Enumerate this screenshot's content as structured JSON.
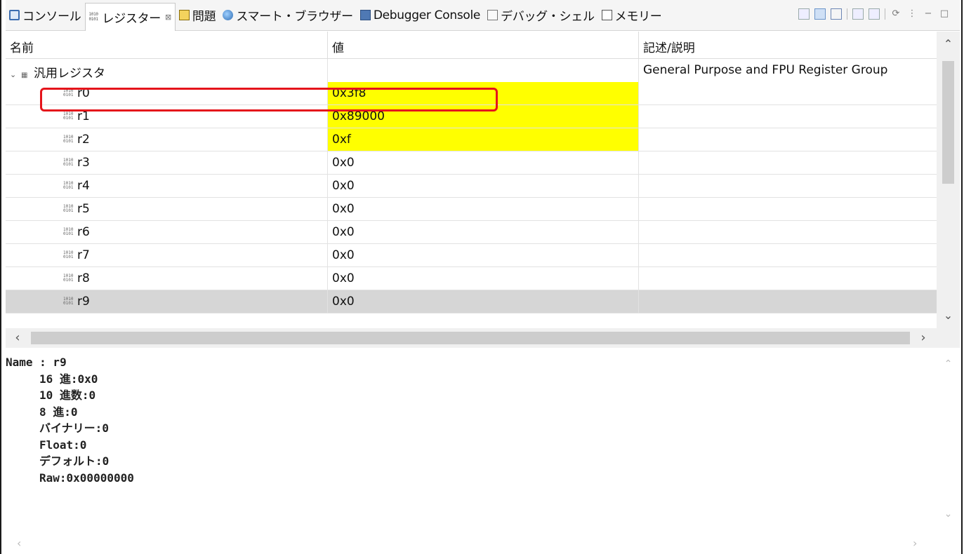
{
  "tabs": [
    {
      "label": "コンソール",
      "icon": "console-icon"
    },
    {
      "label": "レジスター",
      "icon": "register-icon",
      "active": true,
      "close": "⊠"
    },
    {
      "label": "問題",
      "icon": "problems-icon"
    },
    {
      "label": "スマート・ブラウザー",
      "icon": "browser-icon"
    },
    {
      "label": "Debugger Console",
      "icon": "debugger-console-icon"
    },
    {
      "label": "デバッグ・シェル",
      "icon": "shell-icon"
    },
    {
      "label": "メモリー",
      "icon": "memory-icon"
    }
  ],
  "columns": {
    "name": "名前",
    "value": "値",
    "description": "記述/説明"
  },
  "group": {
    "name": "汎用レジスタ",
    "description": "General Purpose and FPU Register Group"
  },
  "registers": [
    {
      "name": "r0",
      "value": "0x3f8",
      "changed": true
    },
    {
      "name": "r1",
      "value": "0x89000",
      "changed": true
    },
    {
      "name": "r2",
      "value": "0xf",
      "changed": true
    },
    {
      "name": "r3",
      "value": "0x0",
      "changed": false
    },
    {
      "name": "r4",
      "value": "0x0",
      "changed": false
    },
    {
      "name": "r5",
      "value": "0x0",
      "changed": false
    },
    {
      "name": "r6",
      "value": "0x0",
      "changed": false
    },
    {
      "name": "r7",
      "value": "0x0",
      "changed": false
    },
    {
      "name": "r8",
      "value": "0x0",
      "changed": false
    },
    {
      "name": "r9",
      "value": "0x0",
      "changed": false,
      "selected": true
    }
  ],
  "detail": {
    "name_line": "Name : r9",
    "lines": [
      "16 進:0x0",
      "10 進数:0",
      "8 進:0",
      "バイナリー:0",
      "Float:0",
      "デフォルト:0",
      "Raw:0x00000000"
    ]
  },
  "colors": {
    "changed_value": "#ffff00",
    "highlight_box": "#e5141b",
    "selected_row": "#d6d6d6"
  }
}
